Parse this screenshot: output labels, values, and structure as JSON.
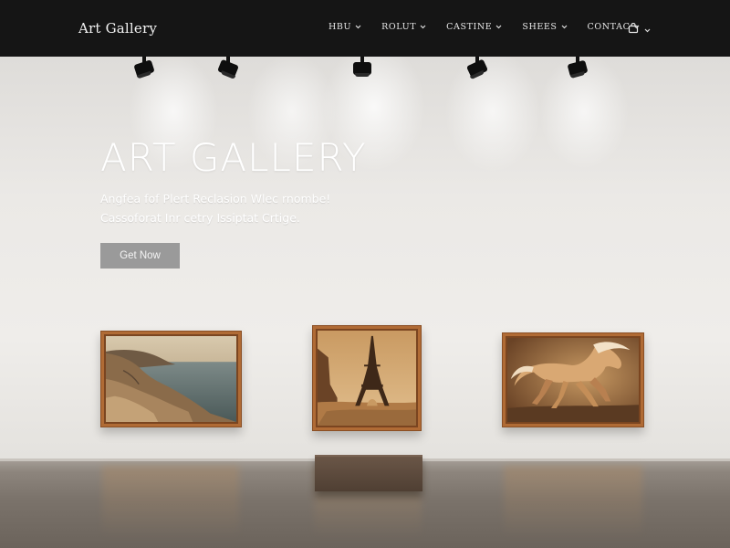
{
  "header": {
    "brand": "Art Gallery",
    "nav": [
      {
        "label": "HBU"
      },
      {
        "label": "ROLUT"
      },
      {
        "label": "CASTINE"
      },
      {
        "label": "SHEES"
      },
      {
        "label": "CONTAC"
      }
    ],
    "bag_icon": "shopping-bag-icon"
  },
  "hero": {
    "title": "ART GALLERY",
    "subtitle_line1": "Angfea fof Plert Reclasion Wlec rnombe!",
    "subtitle_line2": "Cassoforat Inr cetry Issiptat Crtige.",
    "cta_label": "Get Now"
  },
  "artworks": [
    {
      "subject": "coastal cliffs landscape"
    },
    {
      "subject": "eiffel tower in desert"
    },
    {
      "subject": "galloping horse"
    }
  ],
  "colors": {
    "header_bg": "#151515",
    "cta_bg": "#9a9a9a",
    "frame": "#b06b35"
  }
}
